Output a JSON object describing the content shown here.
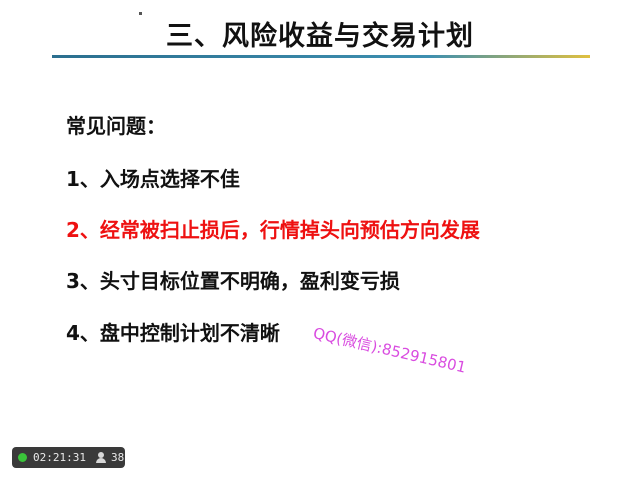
{
  "slide": {
    "title": "三、风险收益与交易计划",
    "heading": "常见问题：",
    "items": [
      {
        "text": "1、入场点选择不佳",
        "color": "#111111"
      },
      {
        "text": "2、经常被扫止损后，行情掉头向预估方向发展",
        "color": "#ee1111"
      },
      {
        "text": "3、头寸目标位置不明确，盈利变亏损",
        "color": "#111111"
      },
      {
        "text": "4、盘中控制计划不清晰",
        "color": "#111111"
      }
    ],
    "watermark": "QQ(微信):852915801"
  },
  "statusbar": {
    "recording_icon": "green-dot-icon",
    "timer": "02:21:31",
    "viewer_icon": "user-icon",
    "viewer_count": "38"
  },
  "colors": {
    "accent_rule": "#2b6f8f",
    "highlight": "#ee1111",
    "watermark": "#d94ce0"
  }
}
